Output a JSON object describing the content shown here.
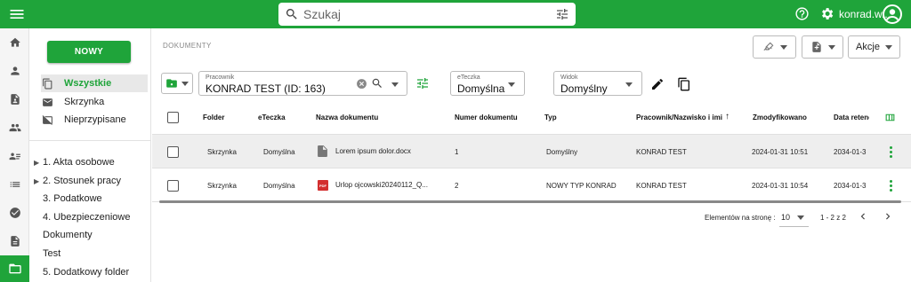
{
  "brand_color": "#1fa43a",
  "topbar": {
    "menu_icon": "menu-icon",
    "search_placeholder": "Szukaj",
    "help_icon": "help-circle-icon",
    "settings_icon": "gear-icon",
    "username": "konrad.w...",
    "avatar_icon": "account-circle-icon"
  },
  "rail": [
    "home-icon",
    "person-icon",
    "person-document-icon",
    "people-icon",
    "person-list-icon",
    "list-icon",
    "check-circle-icon",
    "document-icon",
    "folder-open-icon"
  ],
  "nav": {
    "new_button": "NOWY",
    "filters": [
      {
        "label": "Wszystkie",
        "icon": "documents-icon",
        "active": true
      },
      {
        "label": "Skrzynka",
        "icon": "mail-icon",
        "active": false
      },
      {
        "label": "Nieprzypisane",
        "icon": "mail-off-icon",
        "active": false
      }
    ],
    "folders": [
      {
        "label": "1. Akta osobowe",
        "expandable": true
      },
      {
        "label": "2. Stosunek pracy",
        "expandable": true
      },
      {
        "label": "3. Podatkowe",
        "expandable": false
      },
      {
        "label": "4. Ubezpieczeniowe",
        "expandable": false
      },
      {
        "label": "Dokumenty",
        "expandable": false
      },
      {
        "label": "Test",
        "expandable": false
      },
      {
        "label": "5. Dodatkowy folder",
        "expandable": false
      }
    ]
  },
  "breadcrumb": "DOKUMENTY",
  "toolbar": {
    "sign_icon": "signature-icon",
    "add_doc_icon": "add-document-icon",
    "actions_label": "Akcje"
  },
  "filters": {
    "employee_label": "Pracownik",
    "employee_value": "KONRAD TEST (ID: 163)",
    "eteczka_label": "eTeczka",
    "eteczka_value": "Domyślna",
    "view_label": "Widok",
    "view_value": "Domyślny"
  },
  "table": {
    "columns": [
      "Folder",
      "eTeczka",
      "Nazwa dokumentu",
      "Numer dokumentu",
      "Typ",
      "Pracownik/Nazwisko i imię",
      "Zmodyfikowano",
      "Data retencji"
    ],
    "rows": [
      {
        "folder": "Skrzynka",
        "eteczka": "Domyślna",
        "name": "Lorem ipsum dolor.docx",
        "file_icon": "doc-file-icon",
        "number": "1",
        "type": "Domyślny",
        "employee": "KONRAD TEST",
        "modified": "2024-01-31 10:51",
        "retention": "2034-01-3",
        "pdf_badge": ""
      },
      {
        "folder": "Skrzynka",
        "eteczka": "Domyślna",
        "name": "Urlop ojcowski20240112_Q...",
        "file_icon": "pdf-file-icon",
        "number": "2",
        "type": "NOWY TYP KONRAD",
        "employee": "KONRAD TEST",
        "modified": "2024-01-31 10:54",
        "retention": "2034-01-3",
        "pdf_badge": "PDF"
      }
    ]
  },
  "pagination": {
    "per_page_label": "Elementów na stronę :",
    "per_page_value": "10",
    "range": "1 - 2 z 2"
  }
}
